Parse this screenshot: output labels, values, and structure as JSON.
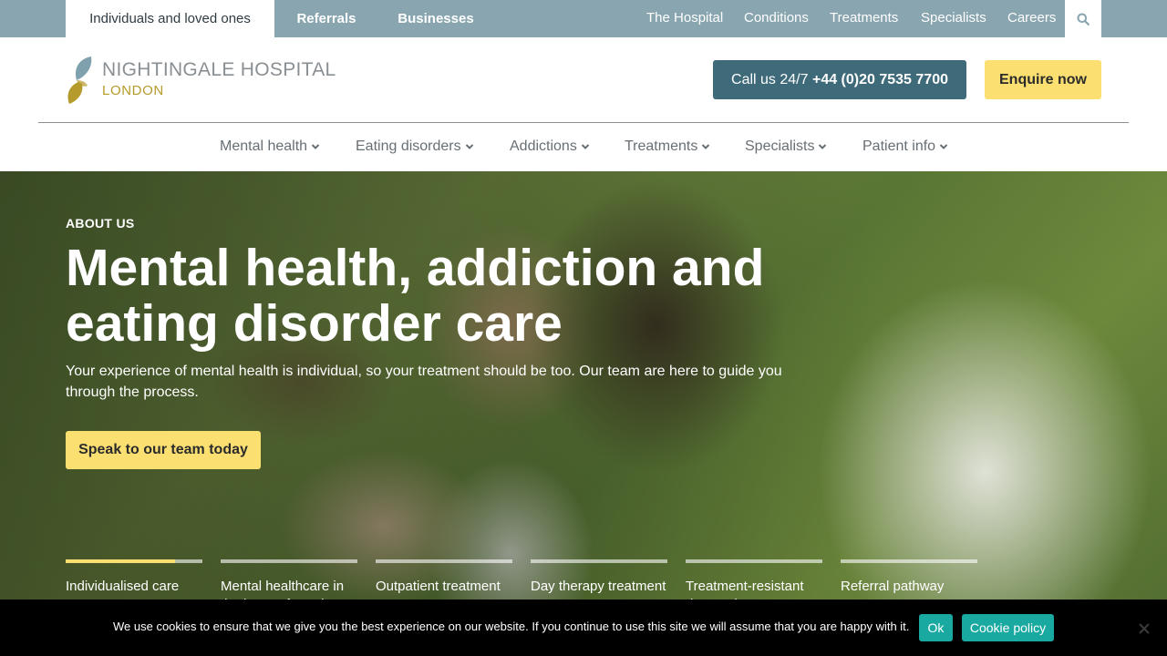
{
  "topbar": {
    "audience_tabs": [
      {
        "label": "Individuals and loved ones",
        "active": true
      },
      {
        "label": "Referrals",
        "active": false
      },
      {
        "label": "Businesses",
        "active": false
      }
    ],
    "links": [
      "The Hospital",
      "Conditions",
      "Treatments",
      "Specialists",
      "Careers"
    ],
    "search_icon": "search-icon"
  },
  "header": {
    "logo_name": "NIGHTINGALE HOSPITAL",
    "logo_sub": "LONDON",
    "call_prefix": "Call us 24/7",
    "call_number": "+44 (0)20 7535 7700",
    "enquire_label": "Enquire now"
  },
  "nav": {
    "items": [
      "Mental health",
      "Eating disorders",
      "Addictions",
      "Treatments",
      "Specialists",
      "Patient info"
    ]
  },
  "hero": {
    "eyebrow": "ABOUT US",
    "headline": "Mental health, addiction and eating disorder care",
    "lede": "Your experience of mental health is individual, so your treatment should be too. Our team are here to guide you through the process.",
    "cta_label": "Speak to our team today",
    "slides": [
      {
        "label": "Individualised care",
        "progress": 0.8
      },
      {
        "label": "Mental healthcare in the heart of London",
        "progress": 0
      },
      {
        "label": "Outpatient treatment",
        "progress": 0
      },
      {
        "label": "Day therapy treatment",
        "progress": 0
      },
      {
        "label": "Treatment-resistant depression",
        "progress": 0
      },
      {
        "label": "Referral pathway",
        "progress": 0
      }
    ]
  },
  "cookie": {
    "text": "We use cookies to ensure that we give you the best experience on our website. If you continue to use this site we will assume that you are happy with it.",
    "ok_label": "Ok",
    "policy_label": "Cookie policy"
  },
  "colors": {
    "topbar": "#88a5b0",
    "call_button": "#3e6a79",
    "accent_yellow": "#fbe071",
    "cookie_button": "#1aa9a0",
    "logo_gold": "#b59a2c"
  }
}
